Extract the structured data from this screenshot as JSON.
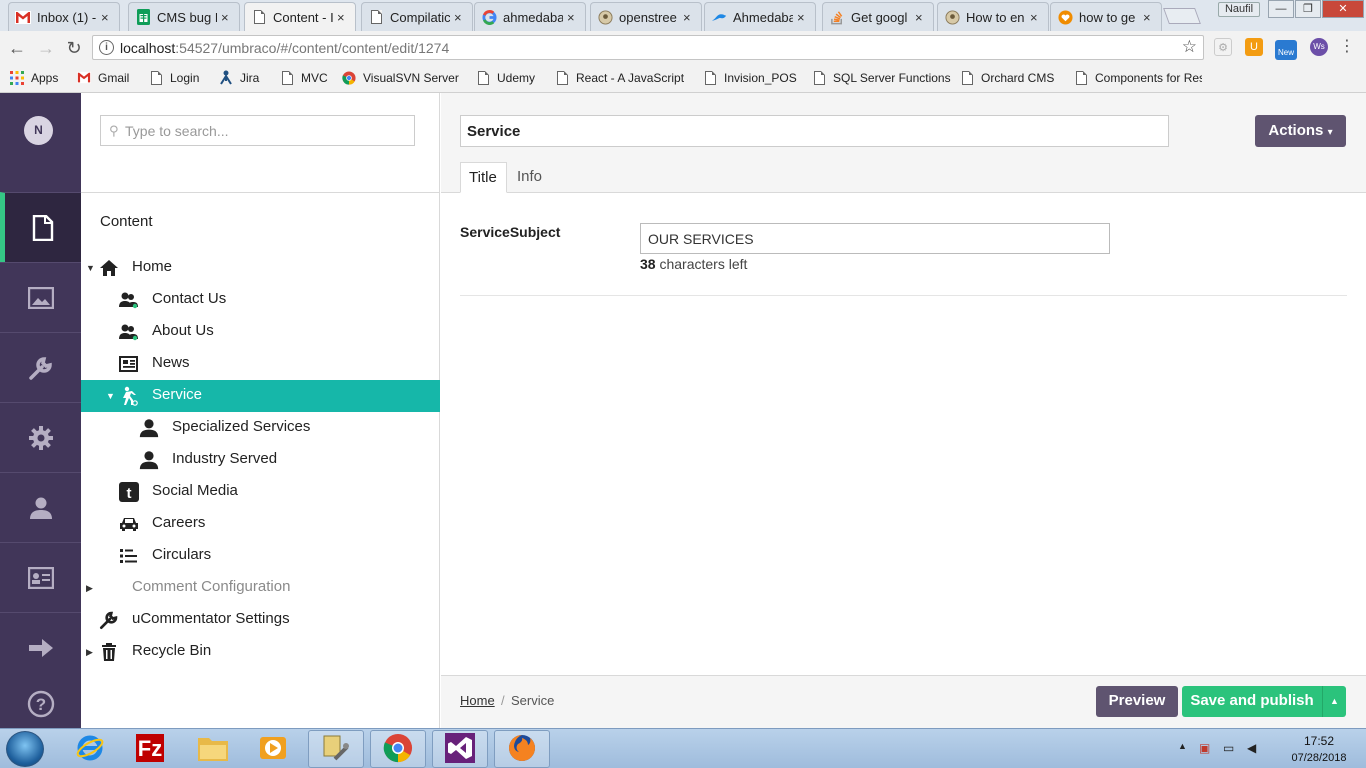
{
  "browser": {
    "tabs": [
      {
        "title": "Inbox (1) -",
        "icon": "gmail-icon",
        "active": false
      },
      {
        "title": "CMS bug I",
        "icon": "sheets-icon",
        "active": false
      },
      {
        "title": "Content - I",
        "icon": "page-icon",
        "active": true
      },
      {
        "title": "Compilatic",
        "icon": "page-icon",
        "active": false
      },
      {
        "title": "ahmedaba",
        "icon": "google-icon",
        "active": false
      },
      {
        "title": "openstree",
        "icon": "osm-icon",
        "active": false
      },
      {
        "title": "Ahmedaba",
        "icon": "bird-icon",
        "active": false
      },
      {
        "title": "Get googl",
        "icon": "stackoverflow-icon",
        "active": false
      },
      {
        "title": "How to en",
        "icon": "osm-icon",
        "active": false
      },
      {
        "title": "how to ge",
        "icon": "heart-icon",
        "active": false
      }
    ],
    "close_glyph": "×",
    "user": "Naufil",
    "window_controls": {
      "minimize": "—",
      "maximize": "❐",
      "close": "✕"
    },
    "url": {
      "host": "localhost",
      "path": ":54527/umbraco/#/content/content/edit/1274"
    },
    "extension_badge": "New",
    "bookmarks": [
      {
        "label": "Apps",
        "icon": "apps-grid-icon"
      },
      {
        "label": "Gmail",
        "icon": "gmail-icon"
      },
      {
        "label": "Login",
        "icon": "page-icon"
      },
      {
        "label": "Jira",
        "icon": "jira-icon"
      },
      {
        "label": "MVC",
        "icon": "page-icon"
      },
      {
        "label": "VisualSVN Server",
        "icon": "chrome-icon"
      },
      {
        "label": "Udemy",
        "icon": "page-icon"
      },
      {
        "label": "React - A JavaScript",
        "icon": "page-icon"
      },
      {
        "label": "Invision_POS",
        "icon": "page-icon"
      },
      {
        "label": "SQL Server Functions",
        "icon": "page-icon"
      },
      {
        "label": "Orchard CMS",
        "icon": "page-icon"
      },
      {
        "label": "Components for Res",
        "icon": "page-icon"
      }
    ]
  },
  "cms": {
    "avatar_initial": "N",
    "sections": [
      {
        "name": "content",
        "icon": "document-icon",
        "active": true
      },
      {
        "name": "media",
        "icon": "image-icon",
        "active": false
      },
      {
        "name": "developer",
        "icon": "wrench-icon",
        "active": false
      },
      {
        "name": "settings",
        "icon": "gear-icon",
        "active": false
      },
      {
        "name": "users",
        "icon": "user-icon",
        "active": false
      },
      {
        "name": "members",
        "icon": "id-card-icon",
        "active": false
      },
      {
        "name": "forms",
        "icon": "arrow-right-icon",
        "active": false
      },
      {
        "name": "help",
        "icon": "help-icon",
        "active": false
      }
    ],
    "search_placeholder": "Type to search...",
    "tree_header": "Content",
    "tree": [
      {
        "label": "Home",
        "level": 0,
        "caret": "▼",
        "icon": "home-icon",
        "active": false,
        "dim": false
      },
      {
        "label": "Contact Us",
        "level": 1,
        "caret": "",
        "icon": "users-icon",
        "active": false,
        "dim": false
      },
      {
        "label": "About Us",
        "level": 1,
        "caret": "",
        "icon": "users-icon",
        "active": false,
        "dim": false
      },
      {
        "label": "News",
        "level": 1,
        "caret": "",
        "icon": "newspaper-icon",
        "active": false,
        "dim": false
      },
      {
        "label": "Service",
        "level": 1,
        "caret": "▼",
        "icon": "walker-icon",
        "active": true,
        "dim": false
      },
      {
        "label": "Specialized Services",
        "level": 2,
        "caret": "",
        "icon": "user-icon",
        "active": false,
        "dim": false
      },
      {
        "label": "Industry Served",
        "level": 2,
        "caret": "",
        "icon": "user-icon",
        "active": false,
        "dim": false
      },
      {
        "label": "Social Media",
        "level": 1,
        "caret": "",
        "icon": "tumblr-icon",
        "active": false,
        "dim": false
      },
      {
        "label": "Careers",
        "level": 1,
        "caret": "",
        "icon": "car-icon",
        "active": false,
        "dim": false
      },
      {
        "label": "Circulars",
        "level": 1,
        "caret": "",
        "icon": "list-icon",
        "active": false,
        "dim": false
      },
      {
        "label": "Comment Configuration",
        "level": 0,
        "caret": "▶",
        "icon": "",
        "active": false,
        "dim": true
      },
      {
        "label": "uCommentator Settings",
        "level": 0,
        "caret": "",
        "icon": "wrench-icon",
        "active": false,
        "dim": false
      },
      {
        "label": "Recycle Bin",
        "level": 0,
        "caret": "▶",
        "icon": "trash-icon",
        "active": false,
        "dim": false
      }
    ],
    "editor": {
      "node_name": "Service",
      "actions_label": "Actions",
      "actions_caret": "▾",
      "tabs": [
        {
          "label": "Title",
          "active": true
        },
        {
          "label": "Info",
          "active": false
        }
      ],
      "property_label": "ServiceSubject",
      "property_value": "OUR SERVICES",
      "chars_left_count": "38",
      "chars_left_text": " characters left",
      "breadcrumb": [
        {
          "label": "Home",
          "link": true
        },
        {
          "label": "Service",
          "link": false
        }
      ],
      "breadcrumb_separator": "/",
      "preview_label": "Preview",
      "save_label": "Save and publish",
      "save_caret": "▲"
    }
  },
  "taskbar": {
    "apps": [
      {
        "name": "internet-explorer",
        "icon": "ie-icon"
      },
      {
        "name": "filezilla",
        "icon": "filezilla-icon"
      },
      {
        "name": "explorer",
        "icon": "folder-icon"
      },
      {
        "name": "media-player",
        "icon": "media-icon"
      },
      {
        "name": "tools",
        "icon": "tools-icon"
      },
      {
        "name": "chrome",
        "icon": "chrome-icon"
      },
      {
        "name": "visual-studio",
        "icon": "vs-icon"
      },
      {
        "name": "firefox",
        "icon": "firefox-icon"
      }
    ],
    "time": "17:52",
    "date": "07/28/2018"
  },
  "colors": {
    "sidebar": "#413659",
    "accent_teal": "#16b7a9",
    "save_green": "#2bc37c",
    "preview_purple": "#5f5470"
  }
}
